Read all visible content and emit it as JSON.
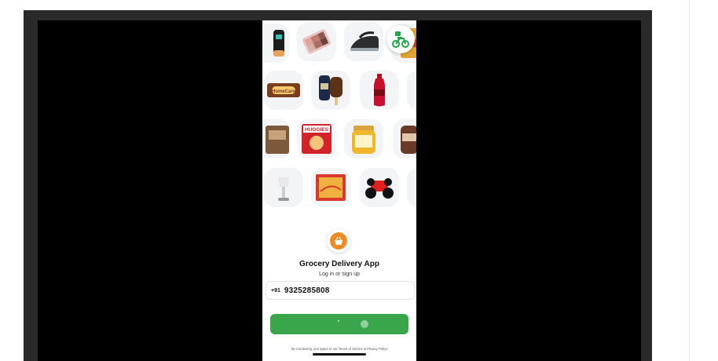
{
  "app": {
    "title": "Grocery Delivery App",
    "subtitle": "Log in or sign up",
    "phone_country_code": "+91",
    "phone_number": "9325285808",
    "terms": "By Continuing, you agree to our Terms of Service & Privacy Policy"
  },
  "product_labels": {
    "biscuit": "HomeCare",
    "diapers": "HUGGIES"
  },
  "colors": {
    "frame": "#2a2a2a",
    "stage": "#000000",
    "button": "#3aa64c",
    "logo": "#f08a24"
  },
  "icons": {
    "delivery": "scooter-delivery-icon",
    "logo": "shopping-basket-icon"
  }
}
